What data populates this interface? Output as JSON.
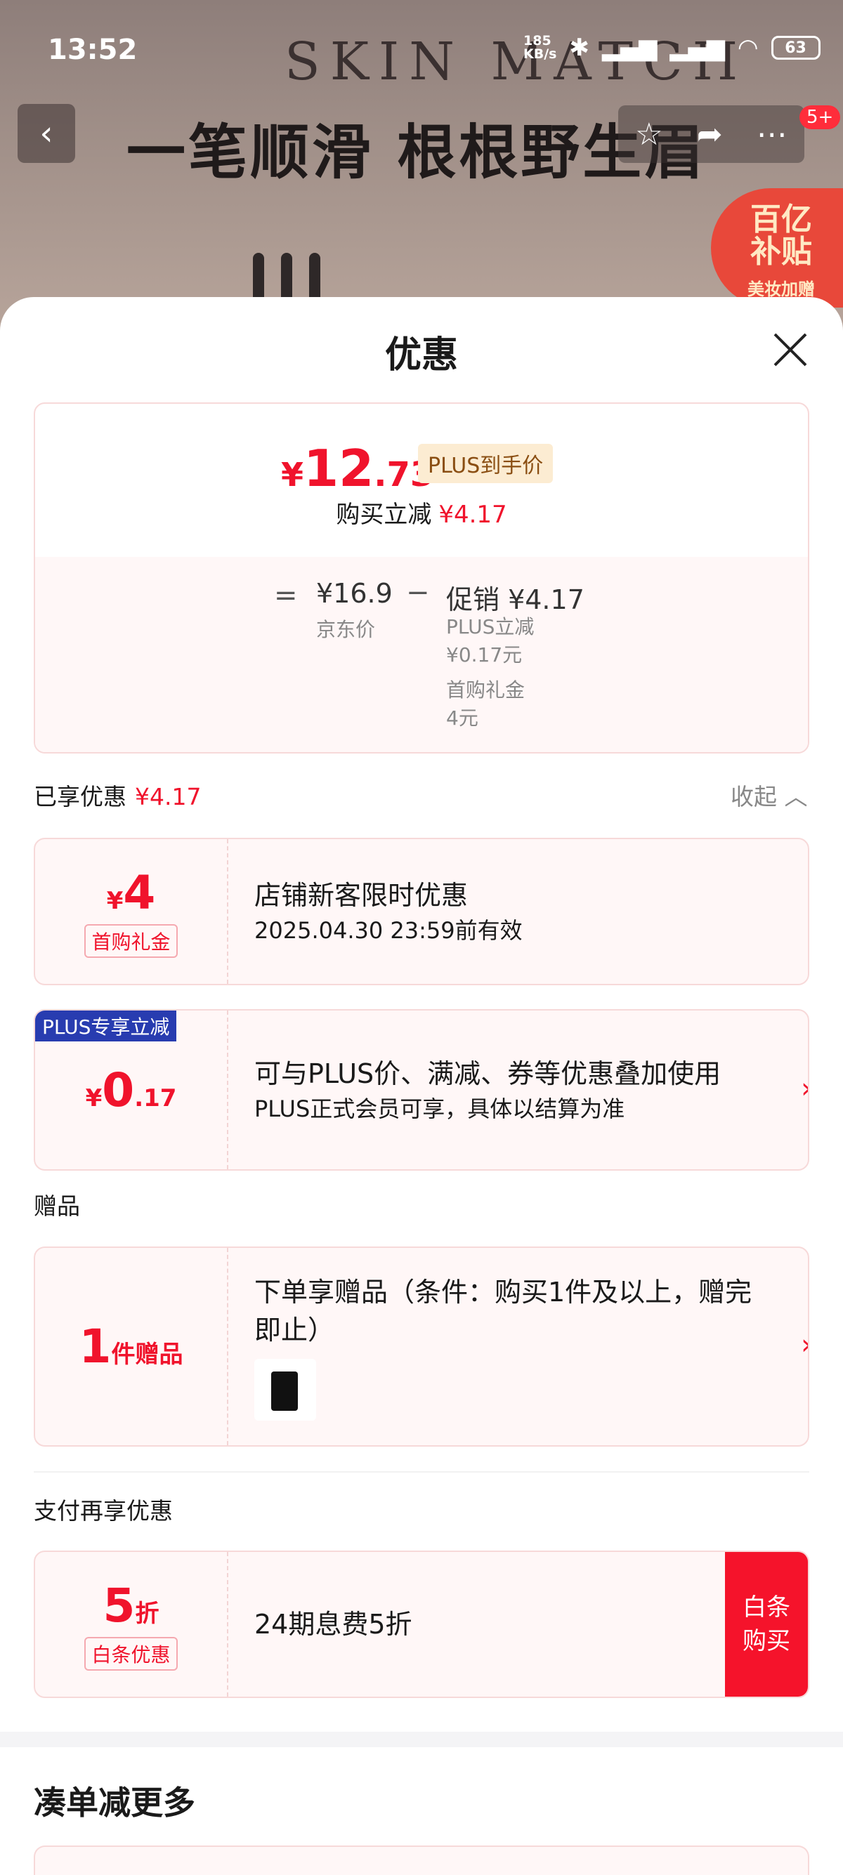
{
  "status_bar": {
    "time": "13:52",
    "net_speed_top": "185",
    "net_speed_bottom": "KB/s",
    "battery": "63"
  },
  "background": {
    "brand": "SKIN MATCH",
    "headline": "一笔顺滑 根根野生眉",
    "notification_badge": "5+",
    "subsidy_line1": "百亿",
    "subsidy_line2": "补贴",
    "subsidy_line3": "美妆加赠"
  },
  "sheet": {
    "title": "优惠"
  },
  "price_summary": {
    "yen": "¥",
    "price_int": "12",
    "price_dec": ".73",
    "plus_tag": "PLUS到手价",
    "save_label": "购买立减",
    "save_value": "¥4.17",
    "equals": "=",
    "jd_price": "¥16.9",
    "jd_label": "京东价",
    "minus": "−",
    "promo_label": "促销 ¥4.17",
    "plus_cut_label": "PLUS立减",
    "plus_cut_value": "¥0.17元",
    "first_gift_label": "首购礼金",
    "first_gift_value": "4元"
  },
  "enjoyed": {
    "label": "已享优惠",
    "value": "¥4.17",
    "collapse": "收起"
  },
  "coupons": [
    {
      "yen": "¥",
      "amount": "4",
      "tag": "首购礼金",
      "title": "店铺新客限时优惠",
      "subtitle": "2025.04.30 23:59前有效"
    },
    {
      "flag": "PLUS专享立减",
      "yen": "¥",
      "amount_int": "0",
      "amount_dec": ".17",
      "title": "可与PLUS价、满减、券等优惠叠加使用",
      "subtitle": "PLUS正式会员可享，具体以结算为准"
    }
  ],
  "gift_section": {
    "label": "赠品",
    "count": "1",
    "unit": "件赠品",
    "title": "下单享赠品（条件：购买1件及以上，赠完即止）"
  },
  "pay_section": {
    "label": "支付再享优惠",
    "amount": "5",
    "unit": "折",
    "tag": "白条优惠",
    "title": "24期息费5折",
    "button": "白条购买"
  },
  "more": {
    "title": "凑单减更多"
  },
  "colors": {
    "accent_red": "#f0132c",
    "plus_blue": "#283cb0",
    "plus_tag_bg": "#fcecd2"
  }
}
